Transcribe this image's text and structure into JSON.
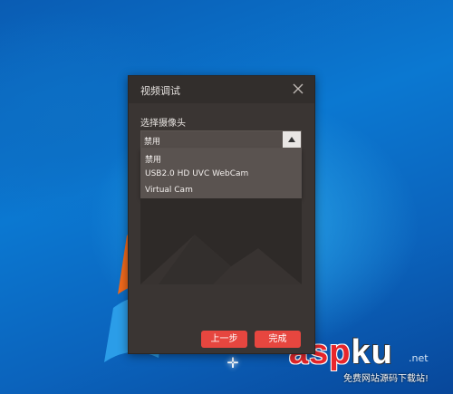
{
  "dialog": {
    "title": "视频调试",
    "section_label": "选择摄像头",
    "select": {
      "selected_value": "禁用",
      "options": [
        "禁用",
        "USB2.0 HD UVC WebCam",
        "Virtual Cam"
      ]
    },
    "buttons": {
      "prev_label": "上一步",
      "done_label": "完成"
    }
  },
  "watermark": {
    "brand_red": "asp",
    "brand_white": "ku",
    "domain_suffix": ".net",
    "tagline": "免费网站源码下载站!"
  },
  "colors": {
    "accent_button": "#e6463f",
    "dialog_bg": "#3a3533",
    "dropdown_bg": "#5a5350",
    "desktop_blue": "#0b78d1"
  },
  "icons": {
    "close": "close-icon",
    "arrow": "triangle-up-icon"
  }
}
